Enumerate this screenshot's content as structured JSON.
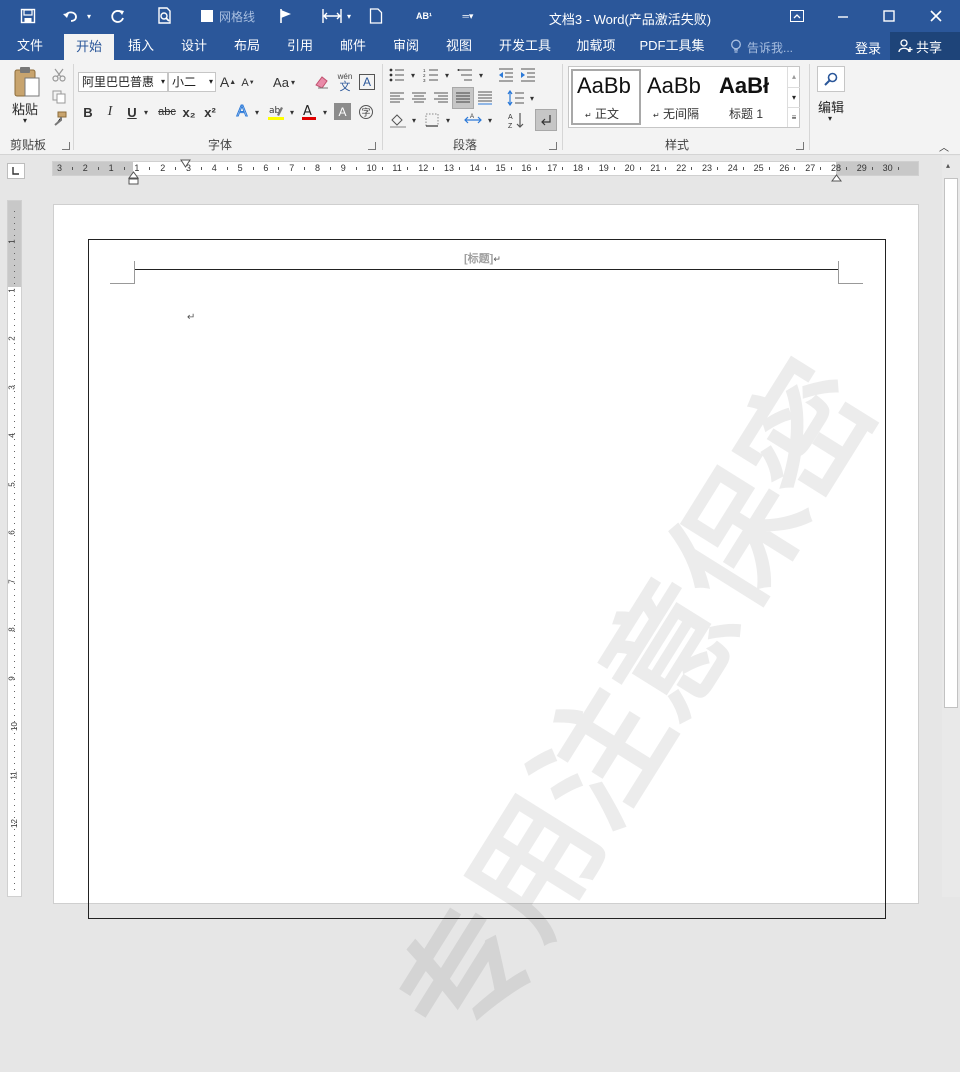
{
  "window": {
    "title": "文档3 - Word(产品激活失败)",
    "gridlines_label": "网格线",
    "login_label": "登录",
    "share_label": "共享",
    "tell_me_placeholder": "告诉我..."
  },
  "tabs": [
    "文件",
    "开始",
    "插入",
    "设计",
    "布局",
    "引用",
    "邮件",
    "审阅",
    "视图",
    "开发工具",
    "加载项",
    "PDF工具集"
  ],
  "ribbon": {
    "paste_label": "粘贴",
    "font_name": "阿里巴巴普惠",
    "font_size": "小二",
    "groups": {
      "clipboard": "剪贴板",
      "font": "字体",
      "paragraph": "段落",
      "styles": "样式",
      "editing": "编辑"
    },
    "styles": [
      {
        "preview": "AaBb",
        "name": "正文"
      },
      {
        "preview": "AaBb",
        "name": "无间隔"
      },
      {
        "preview": "AaBł",
        "name": "标题 1"
      }
    ],
    "font_buttons": {
      "bold": "B",
      "italic": "I",
      "underline": "U",
      "strike": "abc",
      "subscript": "x₂",
      "superscript": "x²",
      "grow": "A",
      "shrink": "A",
      "case": "Aa",
      "phonetic_top": "wén",
      "phonetic_bottom": "文"
    }
  },
  "ruler": {
    "h_labels": [
      "3",
      "2",
      "1",
      "1",
      "2",
      "3",
      "4",
      "5",
      "6",
      "7",
      "8",
      "9",
      "10",
      "11",
      "12",
      "13",
      "14",
      "15",
      "16",
      "17",
      "18",
      "19",
      "20",
      "21",
      "22",
      "23",
      "24",
      "25",
      "26",
      "27",
      "28",
      "29",
      "30"
    ],
    "v_labels": [
      "1",
      "1",
      "2",
      "3",
      "4",
      "5",
      "6",
      "7",
      "8",
      "9",
      "10",
      "11",
      "12"
    ]
  },
  "document": {
    "header_placeholder": "[标题]",
    "paragraph_mark": "↵",
    "watermark": "专用注意保密"
  },
  "colors": {
    "accent": "#2b579a",
    "highlight": "#ffff00",
    "font_color": "#e00000"
  }
}
